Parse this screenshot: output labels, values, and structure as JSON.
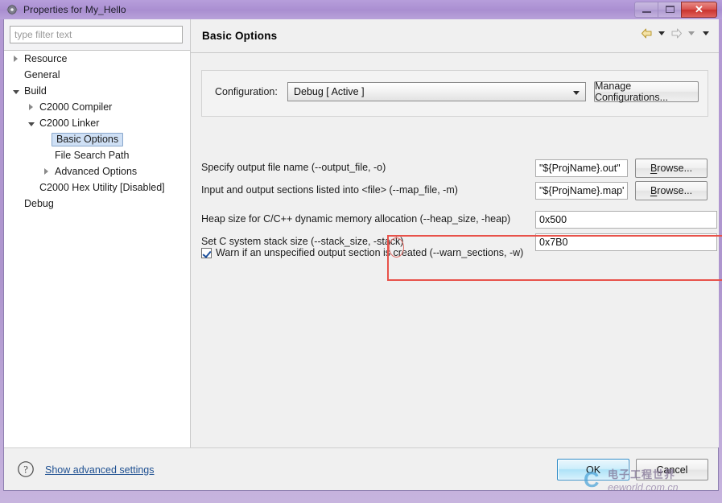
{
  "window": {
    "title": "Properties for My_Hello",
    "app_icon": "properties-icon",
    "minimize_label": "Minimize",
    "maximize_label": "Restore",
    "close_label": "Close",
    "ghost_text": ""
  },
  "sidebar": {
    "filter": {
      "value": "",
      "placeholder": "type filter text"
    },
    "items": [
      {
        "label": "Resource",
        "indent": 0,
        "twisty": "closed",
        "selected": false
      },
      {
        "label": "General",
        "indent": 0,
        "twisty": "none",
        "selected": false
      },
      {
        "label": "Build",
        "indent": 0,
        "twisty": "open",
        "selected": false
      },
      {
        "label": "C2000 Compiler",
        "indent": 1,
        "twisty": "closed",
        "selected": false
      },
      {
        "label": "C2000 Linker",
        "indent": 1,
        "twisty": "open",
        "selected": false
      },
      {
        "label": "Basic Options",
        "indent": 2,
        "twisty": "none",
        "selected": true
      },
      {
        "label": "File Search Path",
        "indent": 2,
        "twisty": "none",
        "selected": false
      },
      {
        "label": "Advanced Options",
        "indent": 2,
        "twisty": "closed",
        "selected": false
      },
      {
        "label": "C2000 Hex Utility  [Disabled]",
        "indent": 1,
        "twisty": "none",
        "selected": false
      },
      {
        "label": "Debug",
        "indent": 0,
        "twisty": "none",
        "selected": false
      }
    ]
  },
  "page": {
    "title": "Basic Options",
    "toolbar": {
      "back_icon": "back-arrow-icon",
      "back_menu_icon": "chevron-down-icon",
      "forward_icon": "forward-arrow-icon",
      "forward_menu_icon": "chevron-down-icon",
      "menu_icon": "chevron-down-icon"
    },
    "configuration": {
      "label": "Configuration:",
      "value": "Debug  [ Active ]",
      "manage_button": "Manage Configurations..."
    },
    "options": [
      {
        "label": "Specify output file name (--output_file, -o)",
        "value": "\"${ProjName}.out\"",
        "browse": "Browse..."
      },
      {
        "label": "Input and output sections listed into <file> (--map_file, -m)",
        "value": "\"${ProjName}.map\"",
        "browse": "Browse..."
      },
      {
        "label": "Heap size for C/C++ dynamic memory allocation (--heap_size, -heap)",
        "value": "0x500",
        "browse": ""
      },
      {
        "label": "Set C system stack size (--stack_size, -stack)",
        "value": "0x7B0",
        "browse": ""
      }
    ],
    "checkbox": {
      "label": "Warn if an unspecified output section is created (--warn_sections, -w)",
      "checked": true
    }
  },
  "footer": {
    "help_icon": "help-question-icon",
    "advanced_link": "Show advanced settings",
    "ok_button": "OK",
    "cancel_button": "Cancel"
  },
  "annotations": {
    "highlight_color": "#e8524a",
    "ellipse_target": "heap-size-label",
    "arrow_target": "warn-sections-checkbox-row"
  },
  "watermark": {
    "logo": "C",
    "cn_text": "电子工程世界",
    "en_text": "eeworld.com.cn"
  }
}
